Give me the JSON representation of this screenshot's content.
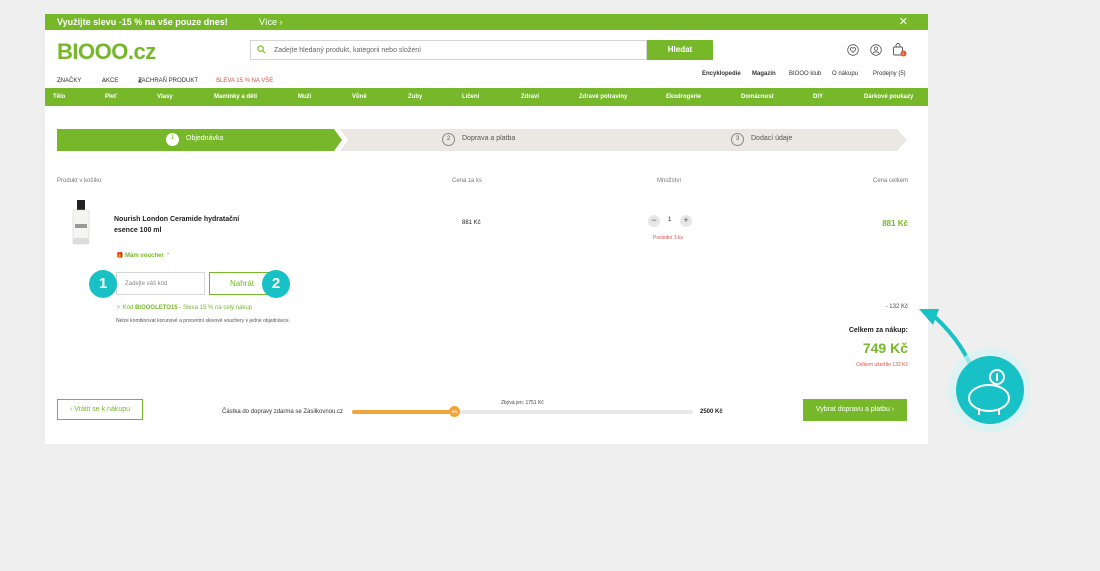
{
  "promo": {
    "text": "Využijte slevu -15 % na vše pouze dnes!",
    "more": "Více  ›",
    "close": "✕"
  },
  "logo": {
    "text": "BIOOO",
    "suffix": ".cz"
  },
  "search": {
    "placeholder": "Zadejte hledaný produkt, kategorii nebo složení",
    "button": "Hledat"
  },
  "cart_count": "1",
  "subnav": {
    "brands": "ZNAČKY",
    "deals": "AKCE",
    "save_product": "ZACHRAŇ PRODUKT",
    "sale": "SLEVA 15 % NA VŠE",
    "encyclopedia": "Encyklopedie",
    "magazine": "Magazín",
    "club": "BIOOO klub",
    "about": "O nákupu",
    "stores": "Prodejny (5)"
  },
  "categories": [
    "Tělo",
    "Pleť",
    "Vlasy",
    "Maminky a děti",
    "Muži",
    "Vůně",
    "Zuby",
    "Líčení",
    "Zdraví",
    "Zdravé potraviny",
    "Ekodrogerie",
    "Domácnost",
    "DIY",
    "Dárkové poukazy"
  ],
  "steps": [
    {
      "num": "1",
      "label": "Objednávka"
    },
    {
      "num": "2",
      "label": "Doprava a platba"
    },
    {
      "num": "3",
      "label": "Dodací údaje"
    }
  ],
  "columns": {
    "product": "Produkt v košíku",
    "unit": "Cena za ks",
    "qty": "Množství",
    "total": "Cena celkem"
  },
  "item": {
    "name": "Nourish London Ceramide hydratační esence 100 ml",
    "unit_price": "881 Kč",
    "quantity": "1",
    "stock_note": "Poslední 3 ks",
    "total": "881 Kč"
  },
  "voucher": {
    "toggle": "Mám voucher",
    "input_placeholder": "Zadejte váš kód",
    "apply": "Nahrát",
    "code_prefix": "Kód",
    "code": "BIOOOLETO15",
    "code_desc": " - Sleva 15 % na celý nákup",
    "note": "Nelze kombinovat korunové a procentní slevové vouchery v jedné objednávce."
  },
  "summary": {
    "discount": "- 132 Kč",
    "label": "Celkem za nákup:",
    "value": "749 Kč",
    "saved": "Celkem ušetříte 132 Kč"
  },
  "shipping": {
    "back": "‹  Vrátit se k nákupu",
    "label": "Částka do dopravy zdarma se Zásilkovnou.cz",
    "remaining": "Zbývá jen: 1751 Kč",
    "percent_label": "0%",
    "target": "2500 Kč",
    "progress": 0.3,
    "next": "Vybrat dopravu a platbu  ›"
  },
  "annotations": {
    "badge1": "1",
    "badge2": "2"
  },
  "colors": {
    "brand": "#76b82a",
    "accent": "#17c1c6",
    "warning": "#d9534f",
    "progress": "#f0a53a"
  }
}
